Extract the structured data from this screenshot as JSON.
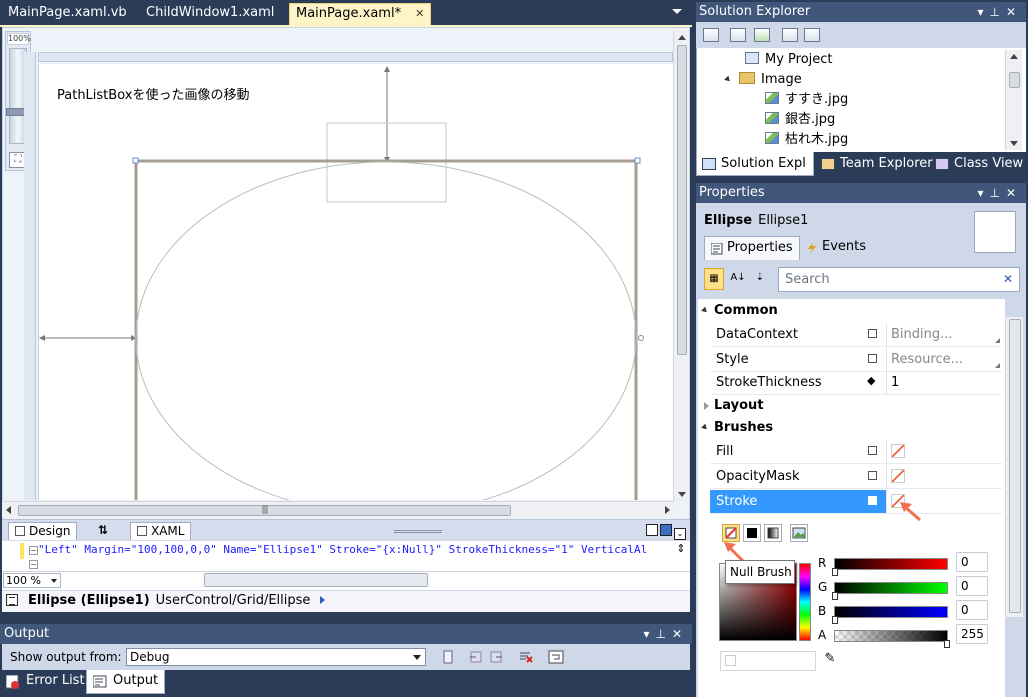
{
  "doc_tabs": [
    {
      "label": "MainPage.xaml.vb",
      "active": false
    },
    {
      "label": "ChildWindow1.xaml",
      "active": false
    },
    {
      "label": "MainPage.xaml*",
      "active": true
    }
  ],
  "designer": {
    "zoom_strip_label": "100%",
    "canvas_text": "PathListBoxを使った画像の移動"
  },
  "split_bar": {
    "design_tab": "Design",
    "swap_glyph": "⇅",
    "xaml_tab": "XAML"
  },
  "xaml_editor": {
    "line": "\"Left\" Margin=\"100,100,0,0\" Name=\"Ellipse1\" Stroke=\"{x:Null}\" StrokeThickness=\"1\" VerticalAl",
    "zoom": "100 %"
  },
  "breadcrumb": {
    "element": "Ellipse (Ellipse1)",
    "path": "UserControl/Grid/Ellipse"
  },
  "output": {
    "title": "Output",
    "show_from_label": "Show output from:",
    "source": "Debug"
  },
  "bottom_tabs": [
    {
      "label": "Error List",
      "active": false
    },
    {
      "label": "Output",
      "active": true
    }
  ],
  "solution_explorer": {
    "title": "Solution Explorer",
    "tree": [
      {
        "label": "My Project",
        "kind": "project"
      },
      {
        "label": "Image",
        "kind": "folder"
      },
      {
        "label": "すすき.jpg",
        "kind": "image"
      },
      {
        "label": "銀杏.jpg",
        "kind": "image"
      },
      {
        "label": "枯れ木.jpg",
        "kind": "image"
      }
    ],
    "tabs": [
      {
        "label": "Solution Expl",
        "active": true
      },
      {
        "label": "Team Explorer",
        "active": false
      },
      {
        "label": "Class View",
        "active": false
      }
    ]
  },
  "properties": {
    "title": "Properties",
    "element_type": "Ellipse",
    "element_name": "Ellipse1",
    "tabs": [
      {
        "label": "Properties",
        "active": true
      },
      {
        "label": "Events",
        "active": false
      }
    ],
    "search_placeholder": "Search",
    "categories": {
      "common": "Common",
      "layout": "Layout",
      "brushes": "Brushes"
    },
    "common_rows": [
      {
        "name": "DataContext",
        "value": "Binding..."
      },
      {
        "name": "Style",
        "value": "Resource..."
      },
      {
        "name": "StrokeThickness",
        "value": "1"
      }
    ],
    "brush_rows": [
      {
        "name": "Fill"
      },
      {
        "name": "OpacityMask"
      },
      {
        "name": "Stroke"
      }
    ],
    "tooltip": "Null Brush",
    "channels": [
      {
        "label": "R",
        "value": "0"
      },
      {
        "label": "G",
        "value": "0"
      },
      {
        "label": "B",
        "value": "0"
      },
      {
        "label": "A",
        "value": "255"
      }
    ]
  },
  "colors": {
    "chrome": "#2b3c59",
    "panel_title": "#40567a",
    "selection": "#3399ff",
    "active_doc_tab": "#fff4c8"
  }
}
